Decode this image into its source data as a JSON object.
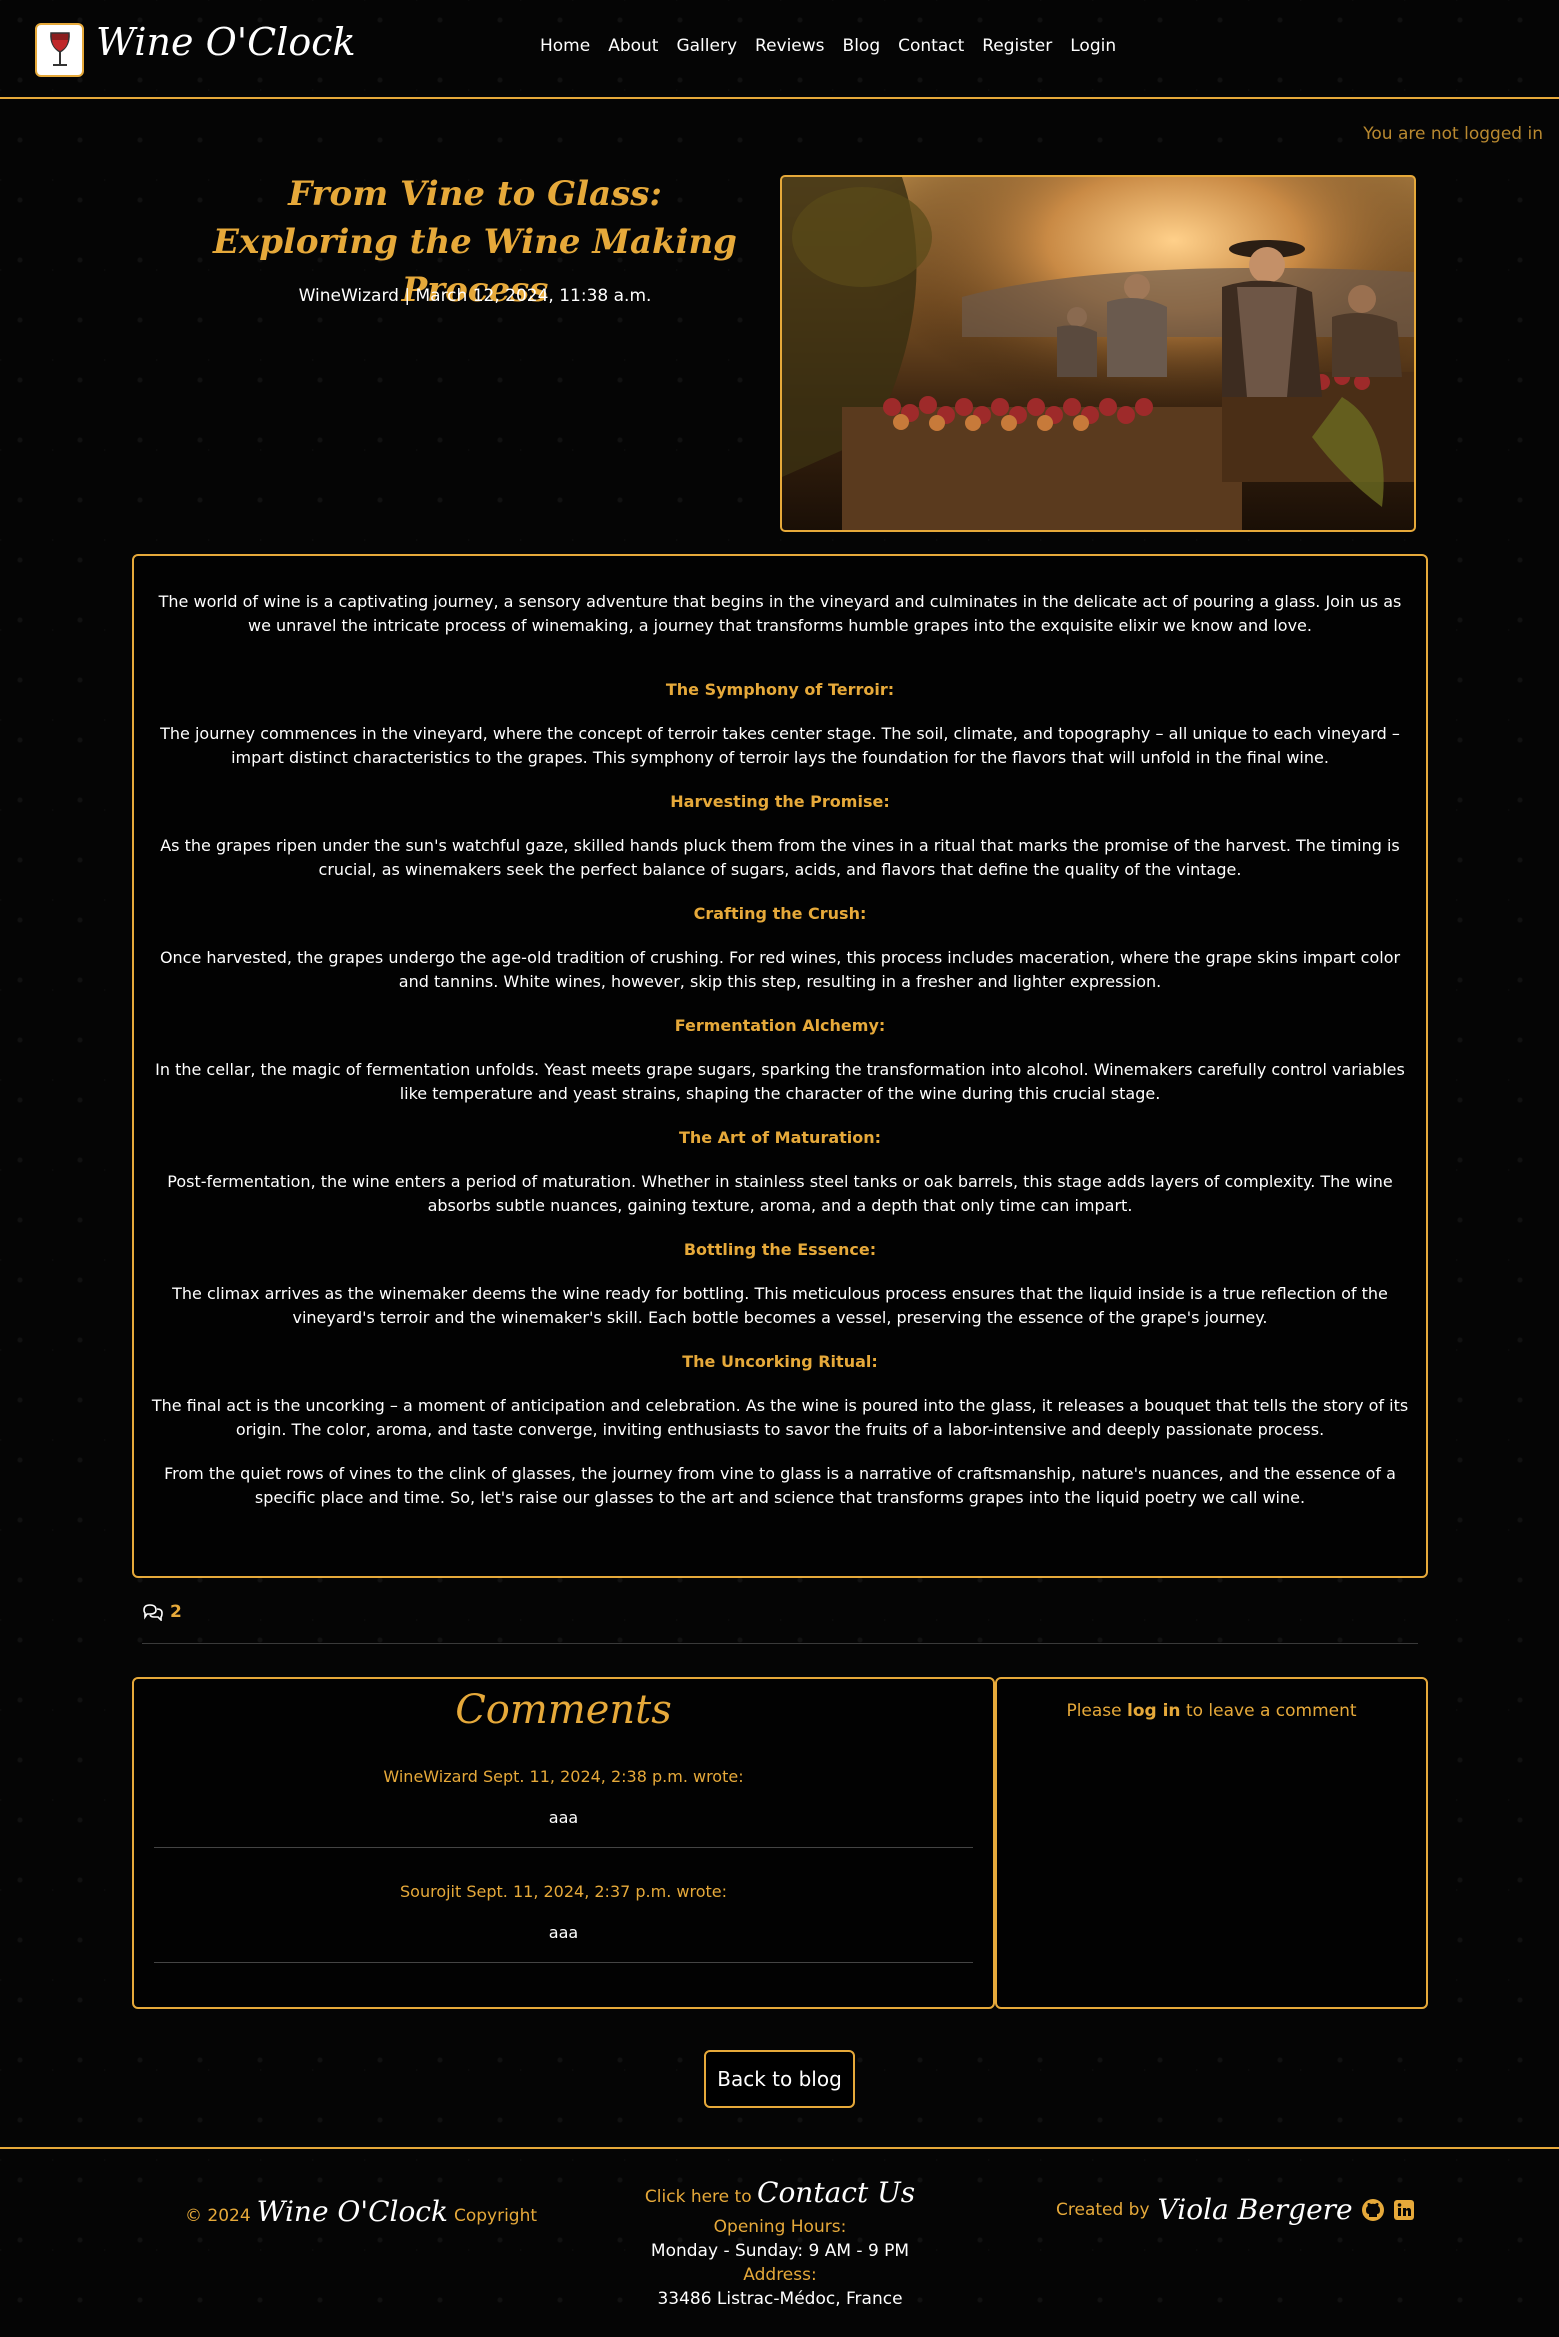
{
  "header": {
    "brand": "Wine O'Clock",
    "nav": [
      "Home",
      "About",
      "Gallery",
      "Reviews",
      "Blog",
      "Contact",
      "Register",
      "Login"
    ]
  },
  "login_status": "You are not logged in",
  "article": {
    "title": "From Vine to Glass: Exploring the Wine Making Process",
    "meta": "WineWizard | March 12, 2024, 11:38 a.m.",
    "intro": "The world of wine is a captivating journey, a sensory adventure that begins in the vineyard and culminates in the delicate act of pouring a glass. Join us as we unravel the intricate process of winemaking, a journey that transforms humble grapes into the exquisite elixir we know and love.",
    "sections": [
      {
        "heading": "The Symphony of Terroir:",
        "text": "The journey commences in the vineyard, where the concept of terroir takes center stage. The soil, climate, and topography – all unique to each vineyard – impart distinct characteristics to the grapes. This symphony of terroir lays the foundation for the flavors that will unfold in the final wine."
      },
      {
        "heading": "Harvesting the Promise:",
        "text": "As the grapes ripen under the sun's watchful gaze, skilled hands pluck them from the vines in a ritual that marks the promise of the harvest. The timing is crucial, as winemakers seek the perfect balance of sugars, acids, and flavors that define the quality of the vintage."
      },
      {
        "heading": "Crafting the Crush:",
        "text": "Once harvested, the grapes undergo the age-old tradition of crushing. For red wines, this process includes maceration, where the grape skins impart color and tannins. White wines, however, skip this step, resulting in a fresher and lighter expression."
      },
      {
        "heading": "Fermentation Alchemy:",
        "text": "In the cellar, the magic of fermentation unfolds. Yeast meets grape sugars, sparking the transformation into alcohol. Winemakers carefully control variables like temperature and yeast strains, shaping the character of the wine during this crucial stage."
      },
      {
        "heading": "The Art of Maturation:",
        "text": "Post-fermentation, the wine enters a period of maturation. Whether in stainless steel tanks or oak barrels, this stage adds layers of complexity. The wine absorbs subtle nuances, gaining texture, aroma, and a depth that only time can impart."
      },
      {
        "heading": "Bottling the Essence:",
        "text": "The climax arrives as the winemaker deems the wine ready for bottling. This meticulous process ensures that the liquid inside is a true reflection of the vineyard's terroir and the winemaker's skill. Each bottle becomes a vessel, preserving the essence of the grape's journey."
      },
      {
        "heading": "The Uncorking Ritual:",
        "text": "The final act is the uncorking – a moment of anticipation and celebration. As the wine is poured into the glass, it releases a bouquet that tells the story of its origin. The color, aroma, and taste converge, inviting enthusiasts to savor the fruits of a labor-intensive and deeply passionate process."
      }
    ],
    "closing": "From the quiet rows of vines to the clink of glasses, the journey from vine to glass is a narrative of craftsmanship, nature's nuances, and the essence of a specific place and time. So, let's raise our glasses to the art and science that transforms grapes into the liquid poetry we call wine."
  },
  "comment_count": "2",
  "comments": {
    "title": "Comments",
    "items": [
      {
        "head": "WineWizard Sept. 11, 2024, 2:38 p.m. wrote:",
        "body": "aaa"
      },
      {
        "head": "Sourojit Sept. 11, 2024, 2:37 p.m. wrote:",
        "body": "aaa"
      }
    ]
  },
  "login_prompt": {
    "before": "Please ",
    "link": "log in",
    "after": " to leave a comment"
  },
  "back_button": "Back to blog",
  "footer": {
    "copy_prefix": "© 2024",
    "copy_brand": "Wine O'Clock",
    "copy_suffix": "Copyright",
    "contact_prefix": "Click here to",
    "contact_link": "Contact Us",
    "hours_label": "Opening Hours:",
    "hours": "Monday - Sunday: 9 AM - 9 PM",
    "address_label": "Address:",
    "address": "33486 Listrac-Médoc, France",
    "created_prefix": "Created by",
    "author": "Viola Bergere"
  },
  "colors": {
    "accent": "#e6a93a",
    "background": "#050505",
    "text": "#ffffff"
  },
  "icons": [
    "wine-glass-logo-icon",
    "comments-icon",
    "github-icon",
    "linkedin-icon"
  ]
}
